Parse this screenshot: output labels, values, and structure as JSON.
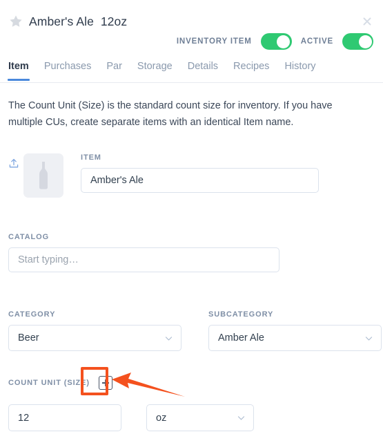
{
  "header": {
    "star_icon": "star-icon",
    "title": "Amber's Ale  12oz",
    "close_icon": "close-icon"
  },
  "toggles": [
    {
      "label": "INVENTORY ITEM",
      "state": "on"
    },
    {
      "label": "ACTIVE",
      "state": "on"
    }
  ],
  "tabs": [
    {
      "label": "Item",
      "active": true
    },
    {
      "label": "Purchases",
      "active": false
    },
    {
      "label": "Par",
      "active": false
    },
    {
      "label": "Storage",
      "active": false
    },
    {
      "label": "Details",
      "active": false
    },
    {
      "label": "Recipes",
      "active": false
    },
    {
      "label": "History",
      "active": false
    }
  ],
  "description": "The Count Unit (Size) is the standard count size for inventory. If you have multiple CUs, create separate items with an identical Item name.",
  "item": {
    "upload_icon": "upload-icon",
    "thumbnail_icon": "bottle-icon",
    "label": "ITEM",
    "value": "Amber's Ale"
  },
  "catalog": {
    "label": "CATALOG",
    "placeholder": "Start typing…",
    "value": ""
  },
  "category": {
    "label": "CATEGORY",
    "value": "Beer"
  },
  "subcategory": {
    "label": "SUBCATEGORY",
    "value": "Amber Ale"
  },
  "count_unit": {
    "label": "COUNT UNIT (SIZE)",
    "add_button_icon": "plus-square-icon",
    "size_value": "12",
    "unit_value": "oz"
  },
  "annotation": {
    "highlight_color": "#f4511e",
    "arrow_icon": "arrow-left-icon"
  },
  "colors": {
    "toggle_on": "#2fc972",
    "tab_active_underline": "#4a89dc",
    "label_text": "#7f8fa6",
    "body_text": "#3b4758",
    "border": "#dbe2ec"
  }
}
